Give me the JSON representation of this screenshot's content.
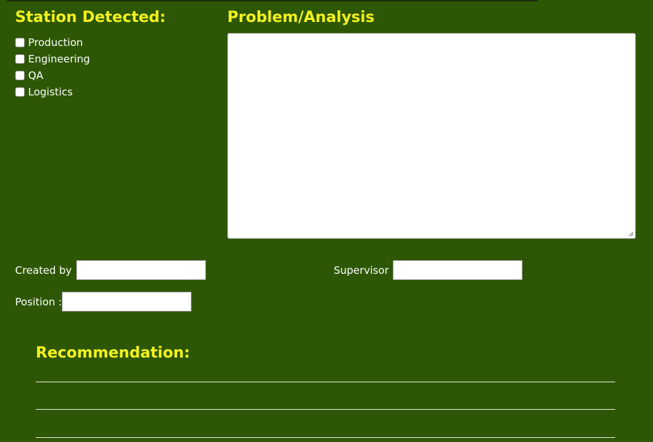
{
  "station": {
    "heading": "Station Detected:",
    "options": [
      {
        "label": "Production",
        "checked": false
      },
      {
        "label": "Engineering",
        "checked": false
      },
      {
        "label": "QA",
        "checked": false
      },
      {
        "label": "Logistics",
        "checked": false
      }
    ]
  },
  "problem": {
    "heading": "Problem/Analysis",
    "value": ""
  },
  "fields": {
    "created_by_label": "Created by :",
    "created_by_value": "",
    "supervisor_label": "Supervisor :",
    "supervisor_value": "",
    "position_label": "Position :",
    "position_value": ""
  },
  "recommendation": {
    "heading": "Recommendation:"
  },
  "colors": {
    "background": "#2d5704",
    "heading": "#f2f21e",
    "text": "#ffffff"
  }
}
